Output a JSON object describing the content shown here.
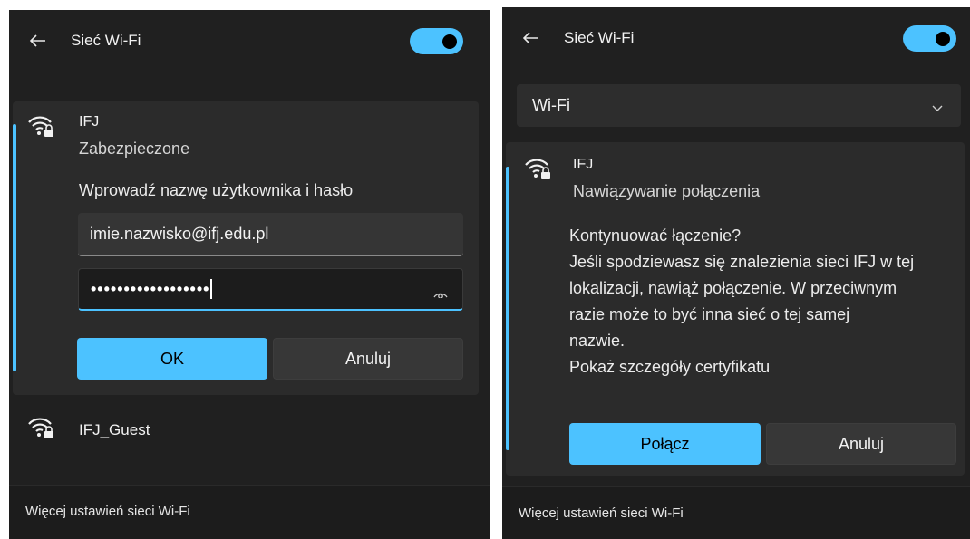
{
  "left_panel": {
    "header": {
      "title": "Sieć Wi-Fi",
      "toggle_on": true
    },
    "networks": [
      {
        "name": "IFJ",
        "status": "Zabezpieczone",
        "prompt": "Wprowadź nazwę użytkownika i hasło",
        "username_value": "imie.nazwisko@ifj.edu.pl",
        "password_value": "••••••••••••••••••",
        "ok_label": "OK",
        "cancel_label": "Anuluj"
      },
      {
        "name": "IFJ_Guest"
      }
    ],
    "footer_link": "Więcej ustawień sieci Wi-Fi"
  },
  "right_panel": {
    "header": {
      "title": "Sieć Wi-Fi",
      "toggle_on": true
    },
    "dropdown": {
      "selected": "Wi-Fi"
    },
    "network": {
      "name": "IFJ",
      "status": "Nawiązywanie połączenia",
      "message_lines": [
        "Kontynuować łączenie?",
        "Jeśli spodziewasz się znalezienia sieci IFJ w tej",
        "lokalizacji, nawiąż połączenie. W przeciwnym",
        "razie może to być inna sieć o tej samej",
        "nazwie.",
        "Pokaż szczegóły certyfikatu"
      ],
      "connect_label": "Połącz",
      "cancel_label": "Anuluj"
    },
    "footer_link": "Więcej ustawień sieci Wi-Fi"
  },
  "colors": {
    "accent": "#4cc2ff",
    "panel_bg": "#202020",
    "card_bg": "#2b2b2b"
  },
  "icons": [
    "back-arrow-icon",
    "wifi-secured-icon",
    "eye-icon",
    "chevron-down-icon"
  ]
}
